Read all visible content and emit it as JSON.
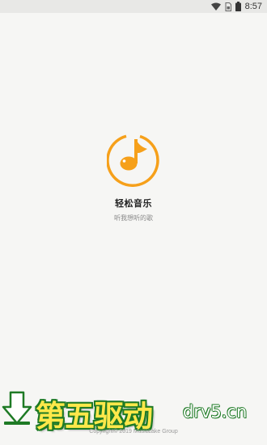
{
  "status_bar": {
    "time": "8:57",
    "icons": [
      "wifi-icon",
      "sim-card-icon",
      "battery-icon"
    ]
  },
  "splash": {
    "logo_icon": "music-note-icon",
    "app_name": "轻松音乐",
    "slogan": "听我想听的歌",
    "copyright": "Copyright© 2019 MusicLake Group"
  },
  "watermark": {
    "text_cn": "第五驱动",
    "domain": "drv5.cn"
  },
  "colors": {
    "background": "#f6f6f4",
    "logo_orange": "#f6a01a",
    "watermark_yellow": "#ffe84a",
    "watermark_green": "#1e7a25"
  }
}
